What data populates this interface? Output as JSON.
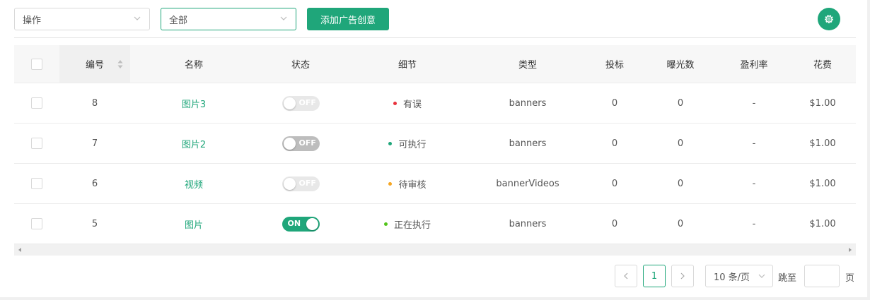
{
  "filters": {
    "action_select": "操作",
    "scope_select": "全部"
  },
  "toolbar": {
    "add_button": "添加广告创意"
  },
  "table": {
    "columns": {
      "id": "编号",
      "name": "名称",
      "status": "状态",
      "detail": "细节",
      "type": "类型",
      "bids": "投标",
      "impressions": "曝光数",
      "profit_rate": "盈利率",
      "cost": "花费"
    },
    "rows": [
      {
        "id": "8",
        "name": "图片3",
        "status": "OFF",
        "detail": "有误",
        "detail_color": "#e8323c",
        "type": "banners",
        "bids": "0",
        "impressions": "0",
        "profit_rate": "-",
        "cost": "$1.00"
      },
      {
        "id": "7",
        "name": "图片2",
        "status": "OFF",
        "detail": "可执行",
        "detail_color": "#1fa67a",
        "type": "banners",
        "bids": "0",
        "impressions": "0",
        "profit_rate": "-",
        "cost": "$1.00"
      },
      {
        "id": "6",
        "name": "视频",
        "status": "OFF",
        "detail": "待审核",
        "detail_color": "#f5a623",
        "type": "bannerVideos",
        "bids": "0",
        "impressions": "0",
        "profit_rate": "-",
        "cost": "$1.00"
      },
      {
        "id": "5",
        "name": "图片",
        "status": "ON",
        "detail": "正在执行",
        "detail_color": "#52c41a",
        "type": "banners",
        "bids": "0",
        "impressions": "0",
        "profit_rate": "-",
        "cost": "$1.00"
      }
    ]
  },
  "pagination": {
    "current_page": "1",
    "page_size": "10 条/页",
    "jump_label": "跳至",
    "page_unit": "页"
  },
  "colors": {
    "accent": "#1fa67a"
  }
}
